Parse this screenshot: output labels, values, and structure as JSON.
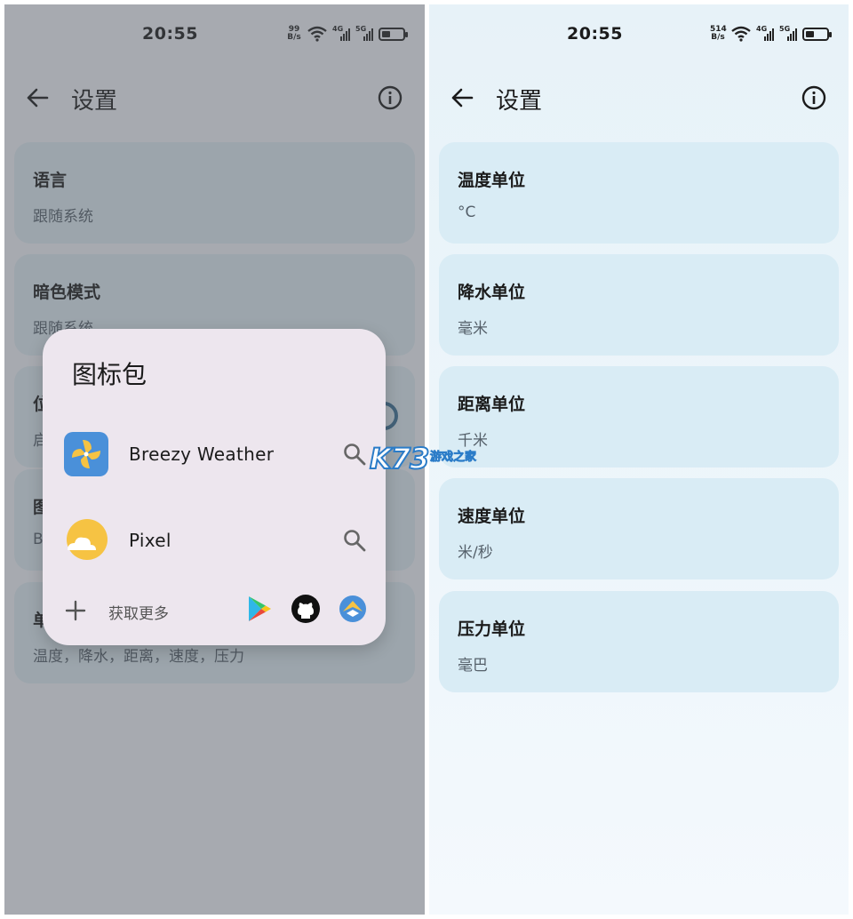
{
  "status": {
    "time": "20:55",
    "left_speed": [
      "99",
      "B/s"
    ],
    "right_speed": [
      "514",
      "B/s"
    ],
    "sim1": "4G",
    "sim2": "5G"
  },
  "left": {
    "appbar_title": "设置",
    "cards": [
      {
        "title": "语言",
        "subtitle": "跟随系统"
      },
      {
        "title": "暗色模式",
        "subtitle": "跟随系统"
      },
      {
        "title": "位",
        "subtitle": "启"
      },
      {
        "title": "图",
        "subtitle": "B"
      },
      {
        "title": "单",
        "subtitle": "温度，降水，距离，速度，压力"
      }
    ],
    "dialog": {
      "title": "图标包",
      "packs": [
        {
          "name": "Breezy Weather",
          "icon": "breezy-weather-icon"
        },
        {
          "name": "Pixel",
          "icon": "pixel-weather-icon"
        }
      ],
      "more_label": "获取更多",
      "stores": [
        "google-play-icon",
        "github-icon",
        "breezy-store-icon"
      ]
    }
  },
  "right": {
    "appbar_title": "设置",
    "cards": [
      {
        "title": "温度单位",
        "subtitle": "°C"
      },
      {
        "title": "降水单位",
        "subtitle": "毫米"
      },
      {
        "title": "距离单位",
        "subtitle": "千米"
      },
      {
        "title": "速度单位",
        "subtitle": "米/秒"
      },
      {
        "title": "压力单位",
        "subtitle": "毫巴"
      }
    ]
  },
  "watermark": {
    "text": "K73",
    "sub": "游戏之家"
  },
  "colors": {
    "accent": "#4a90d9",
    "sun": "#f6c343",
    "card": "#d9ecf5"
  }
}
